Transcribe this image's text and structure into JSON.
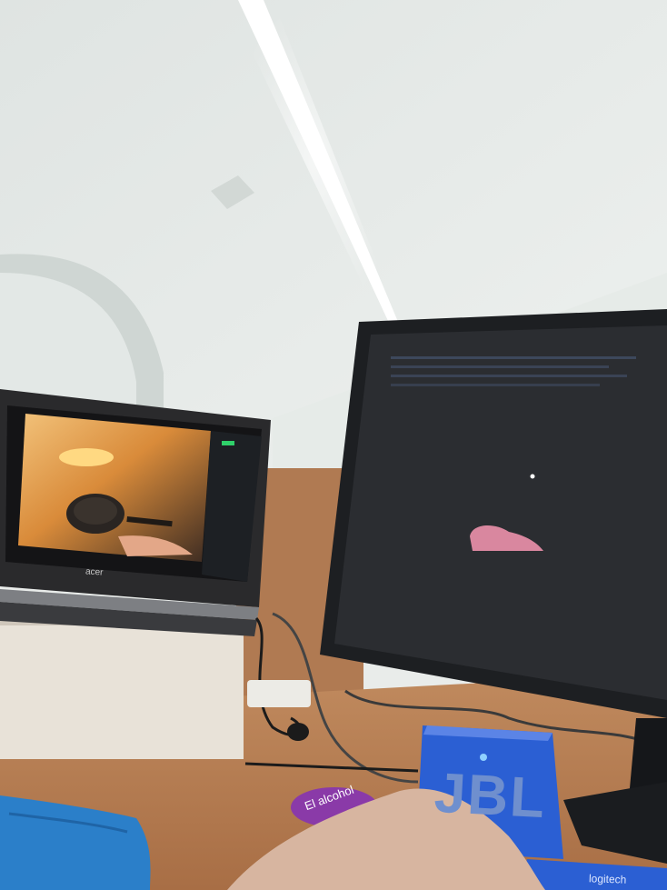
{
  "scene": {
    "laptop_brand": "acer",
    "speaker_brand": "JBL",
    "mouse_brand": "logitech",
    "sticker_text": "El alcohol"
  },
  "colors": {
    "ceiling": "#e4e8e6",
    "wall": "#d9dfdc",
    "desk": "#b57b50",
    "partition": "#b07a52",
    "monitor_body": "#1d1f22",
    "monitor_screen": "#2b2d31",
    "pink_shape": "#d9879f",
    "speaker": "#2b5fd3",
    "laptop_body": "#2a2a2c",
    "light_tube": "#ffffff",
    "jacket": "#2b7fc9",
    "hand": "#d7b5a0"
  },
  "icons": [
    "laptop-icon",
    "monitor-icon",
    "speaker-icon",
    "mouse-icon",
    "ceiling-light-icon"
  ]
}
